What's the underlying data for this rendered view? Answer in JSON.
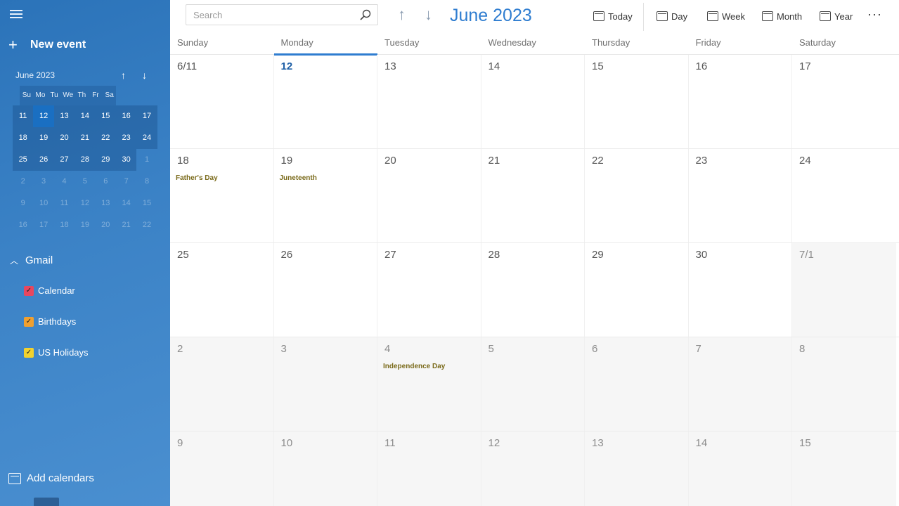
{
  "sidebar": {
    "new_event_label": "New event",
    "mini_calendar": {
      "title": "June 2023",
      "weekdays": [
        "Su",
        "Mo",
        "Tu",
        "We",
        "Th",
        "Fr",
        "Sa"
      ],
      "weeks": [
        [
          "11",
          "12",
          "13",
          "14",
          "15",
          "16",
          "17"
        ],
        [
          "18",
          "19",
          "20",
          "21",
          "22",
          "23",
          "24"
        ],
        [
          "25",
          "26",
          "27",
          "28",
          "29",
          "30",
          "1"
        ],
        [
          "2",
          "3",
          "4",
          "5",
          "6",
          "7",
          "8"
        ],
        [
          "9",
          "10",
          "11",
          "12",
          "13",
          "14",
          "15"
        ],
        [
          "16",
          "17",
          "18",
          "19",
          "20",
          "21",
          "22"
        ]
      ]
    },
    "account": {
      "name": "Gmail"
    },
    "calendars": [
      {
        "label": "Calendar",
        "color": "#e8475f"
      },
      {
        "label": "Birthdays",
        "color": "#f0a030"
      },
      {
        "label": "US Holidays",
        "color": "#f2d22e"
      }
    ],
    "add_calendars_label": "Add calendars"
  },
  "toolbar": {
    "search_placeholder": "Search",
    "month_title": "June 2023",
    "buttons": [
      {
        "label": "Today",
        "icon": "calendar-today-icon"
      },
      {
        "label": "Day",
        "icon": "calendar-day-icon"
      },
      {
        "label": "Week",
        "icon": "calendar-week-icon"
      },
      {
        "label": "Month",
        "icon": "calendar-month-icon"
      },
      {
        "label": "Year",
        "icon": "calendar-year-icon"
      }
    ],
    "more_label": "···"
  },
  "month_view": {
    "weekdays": [
      "Sunday",
      "Monday",
      "Tuesday",
      "Wednesday",
      "Thursday",
      "Friday",
      "Saturday"
    ],
    "weeks": [
      [
        "6/11",
        "12",
        "13",
        "14",
        "15",
        "16",
        "17"
      ],
      [
        "18",
        "19",
        "20",
        "21",
        "22",
        "23",
        "24"
      ],
      [
        "25",
        "26",
        "27",
        "28",
        "29",
        "30",
        "7/1"
      ],
      [
        "2",
        "3",
        "4",
        "5",
        "6",
        "7",
        "8"
      ],
      [
        "9",
        "10",
        "11",
        "12",
        "13",
        "14",
        "15"
      ]
    ],
    "events": [
      {
        "week": 1,
        "day": 0,
        "title": "Father's Day"
      },
      {
        "week": 1,
        "day": 1,
        "title": "Juneteenth"
      },
      {
        "week": 3,
        "day": 2,
        "title": "Independence Day"
      }
    ]
  }
}
